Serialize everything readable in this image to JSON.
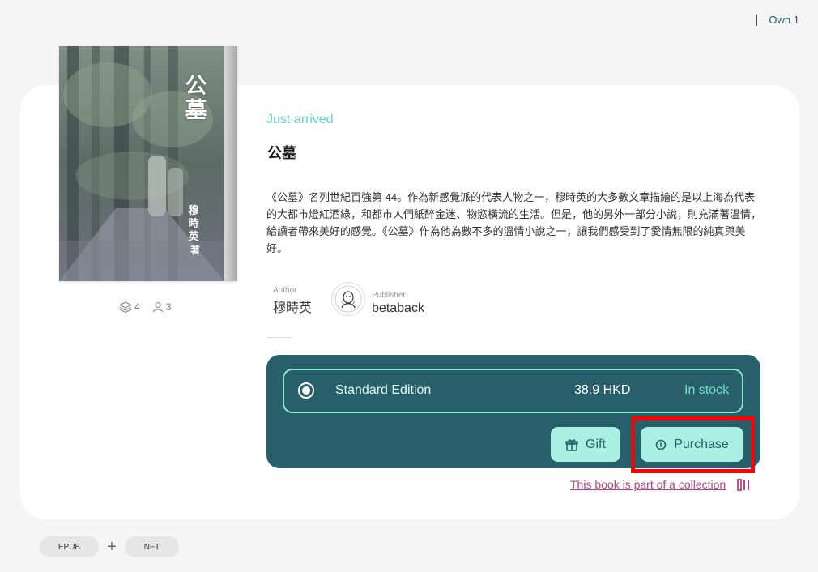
{
  "header": {
    "own_label": "Own 1"
  },
  "book": {
    "cover_title": "公墓",
    "cover_author": "穆時英",
    "cover_author_suffix": "著",
    "badge": "Just arrived",
    "title": "公墓",
    "description": "《公墓》名列世紀百強第 44。作為新感覺派的代表人物之一，穆時英的大多數文章描繪的是以上海為代表的大都市燈紅酒綠，和都市人們紙醉金迷、物慾橫流的生活。但是，他的另外一部分小說，則充滿著溫情，給讀者帶來美好的感覺。《公墓》作為他為數不多的溫情小說之一，讓我們感受到了愛情無限的純真與美好。",
    "stats": {
      "layers": "4",
      "readers": "3"
    },
    "author_label": "Author",
    "author": "穆時英",
    "publisher_label": "Publisher",
    "publisher": "betaback"
  },
  "edition": {
    "name": "Standard Edition",
    "price": "38.9 HKD",
    "stock": "In stock"
  },
  "actions": {
    "gift_label": "Gift",
    "purchase_label": "Purchase",
    "collection_link": "This book is part of a collection"
  },
  "tags": {
    "epub": "EPUB",
    "plus": "+",
    "nft": "NFT"
  },
  "colors": {
    "accent_teal": "#27606a",
    "mint": "#a9f0e3",
    "badge_green": "#66d6c2",
    "link_pink": "#b5457e",
    "highlight_red": "#ff0000"
  }
}
